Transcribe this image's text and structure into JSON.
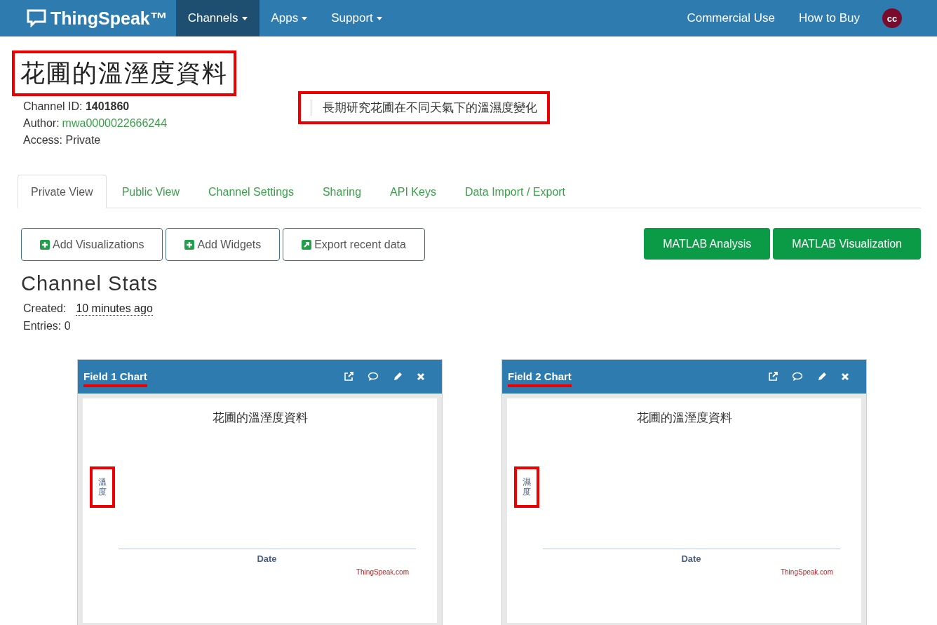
{
  "navbar": {
    "brand": "ThingSpeak™",
    "menus": [
      {
        "label": "Channels",
        "caret": true,
        "selected": true
      },
      {
        "label": "Apps",
        "caret": true,
        "selected": false
      },
      {
        "label": "Support",
        "caret": true,
        "selected": false
      }
    ],
    "right_links": [
      "Commercial Use",
      "How to Buy"
    ],
    "avatar": "cc"
  },
  "channel": {
    "title": "花圃的溫溼度資料",
    "title_highlighted": true,
    "description": "長期研究花圃在不同天氣下的溫濕度變化",
    "description_highlighted": true,
    "id_label": "Channel ID:",
    "id": "1401860",
    "author_label": "Author:",
    "author": "mwa0000022666244",
    "access": "Access: Private"
  },
  "tabs": [
    {
      "label": "Private View",
      "selected": true
    },
    {
      "label": "Public View",
      "selected": false
    },
    {
      "label": "Channel Settings",
      "selected": false
    },
    {
      "label": "Sharing",
      "selected": false
    },
    {
      "label": "API Keys",
      "selected": false
    },
    {
      "label": "Data Import / Export",
      "selected": false
    }
  ],
  "actions": [
    {
      "label": "Add Visualizations",
      "kind": "plus"
    },
    {
      "label": "Add Widgets",
      "kind": "plus"
    },
    {
      "label": "Export recent data",
      "kind": "export"
    }
  ],
  "matlab_buttons": [
    "MATLAB Analysis",
    "MATLAB Visualization"
  ],
  "stats": {
    "heading": "Channel Stats",
    "created_label": "Created:",
    "created": "10 minutes ago",
    "entries": "Entries: 0"
  },
  "charts": [
    {
      "title": "Field 1 Chart",
      "title_underlined": true,
      "chart_title": "花圃的溫溼度資料",
      "ylabel": "溫度",
      "ylabel_highlighted": true,
      "xlabel": "Date",
      "credit": "ThingSpeak.com"
    },
    {
      "title": "Field 2 Chart",
      "title_underlined": true,
      "chart_title": "花圃的溫溼度資料",
      "ylabel": "濕度",
      "ylabel_highlighted": true,
      "xlabel": "Date",
      "credit": "ThingSpeak.com"
    }
  ]
}
